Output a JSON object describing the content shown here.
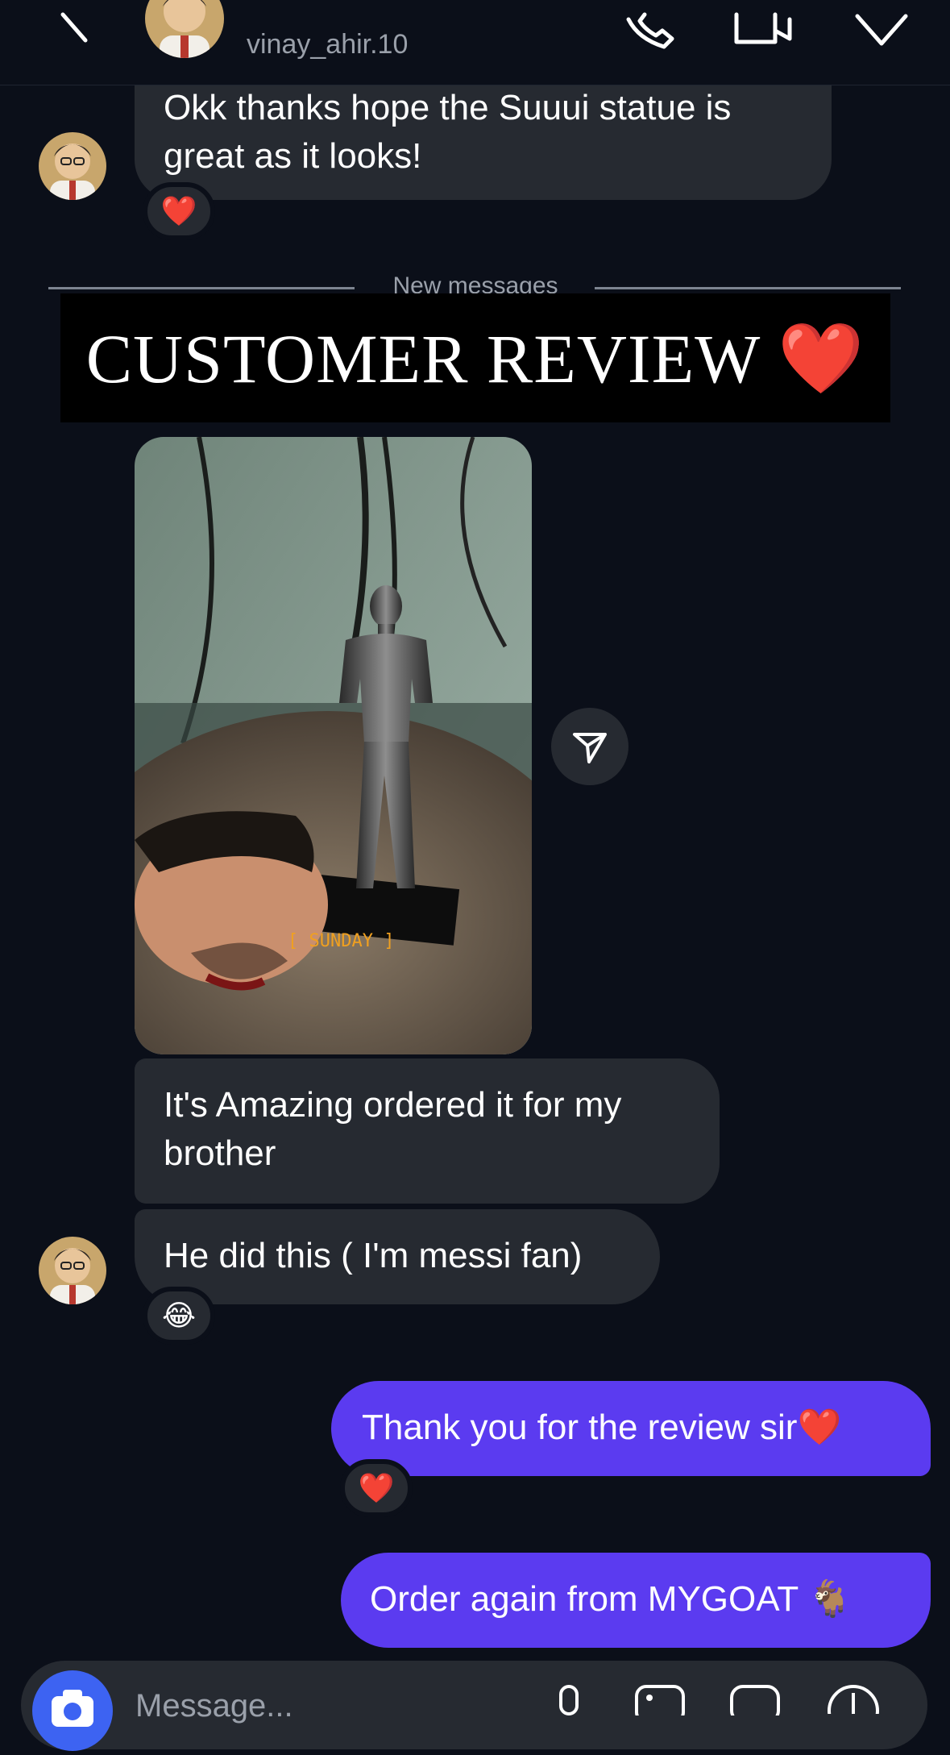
{
  "header": {
    "username": "vinay_ahir.10",
    "icons": [
      "back-icon",
      "phone-icon",
      "video-icon",
      "flag-icon"
    ]
  },
  "messages": {
    "m1_line1": "Okk thanks hope the Suuui statue is",
    "m1_line2": "great as it looks!",
    "m1_reaction": "❤️",
    "divider": "New messages",
    "banner": "CUSTOMER REVIEW ❤️",
    "photo_label": "[ SUNDAY ]",
    "m2_line1": "It's Amazing ordered it for my",
    "m2_line2": "brother",
    "m3": "He did this ( I'm messi fan)",
    "m3_reaction": "😂",
    "m4": "Thank you for the review sir❤️",
    "m4_reaction": "❤️",
    "m5": "Order again from MYGOAT 🐐"
  },
  "composer": {
    "placeholder": "Message..."
  },
  "colors": {
    "background": "#0b0f19",
    "incoming_bubble": "#262a31",
    "outgoing_bubble": "#5b3bf0",
    "camera_button": "#3d63f2"
  }
}
